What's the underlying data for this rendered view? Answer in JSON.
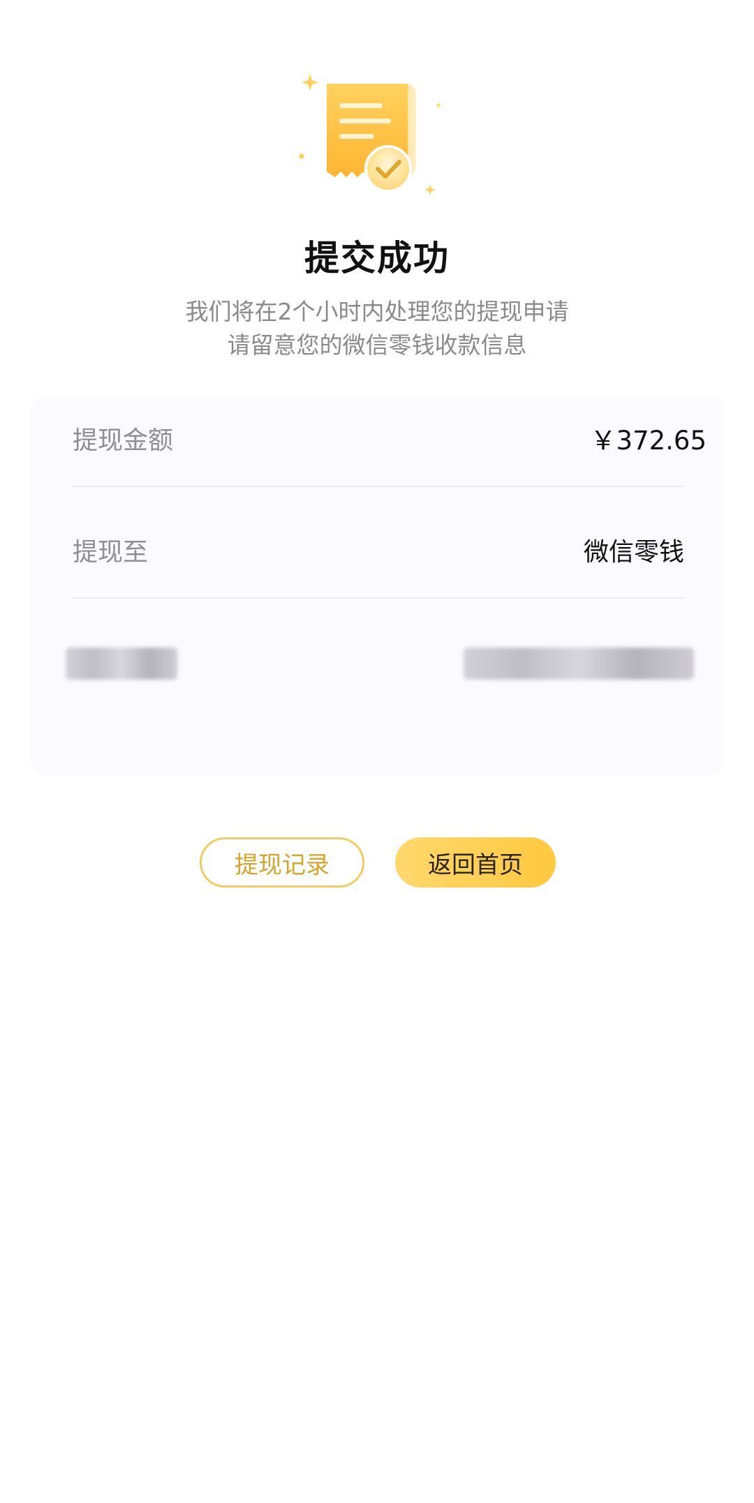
{
  "header": {
    "icon": "receipt-check-icon",
    "title": "提交成功",
    "subtitle_line1": "我们将在2个小时内处理您的提现申请",
    "subtitle_line2": "请留意您的微信零钱收款信息"
  },
  "details": {
    "amount_label": "提现金额",
    "amount_value": "￥372.65",
    "destination_label": "提现至",
    "destination_value": "微信零钱"
  },
  "actions": {
    "records_label": "提现记录",
    "home_label": "返回首页"
  },
  "colors": {
    "accent": "#FFC93F",
    "accent_text": "#D7A52C",
    "muted_text": "#8A8A8A",
    "card_bg": "#FBFAFF"
  }
}
